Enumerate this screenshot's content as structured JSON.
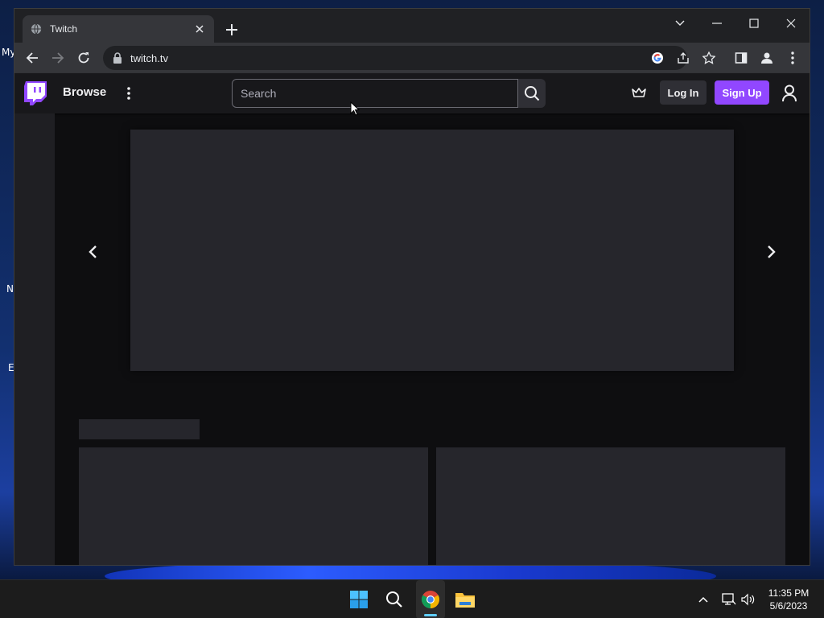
{
  "desktop": {
    "icon_labels": [
      "My",
      "N",
      "E"
    ]
  },
  "browser": {
    "tab": {
      "title": "Twitch"
    },
    "address": "twitch.tv"
  },
  "twitch": {
    "browse_label": "Browse",
    "search_placeholder": "Search",
    "login_label": "Log In",
    "signup_label": "Sign Up",
    "brand_color": "#9147ff"
  },
  "taskbar": {
    "time": "11:35 PM",
    "date": "5/6/2023"
  }
}
